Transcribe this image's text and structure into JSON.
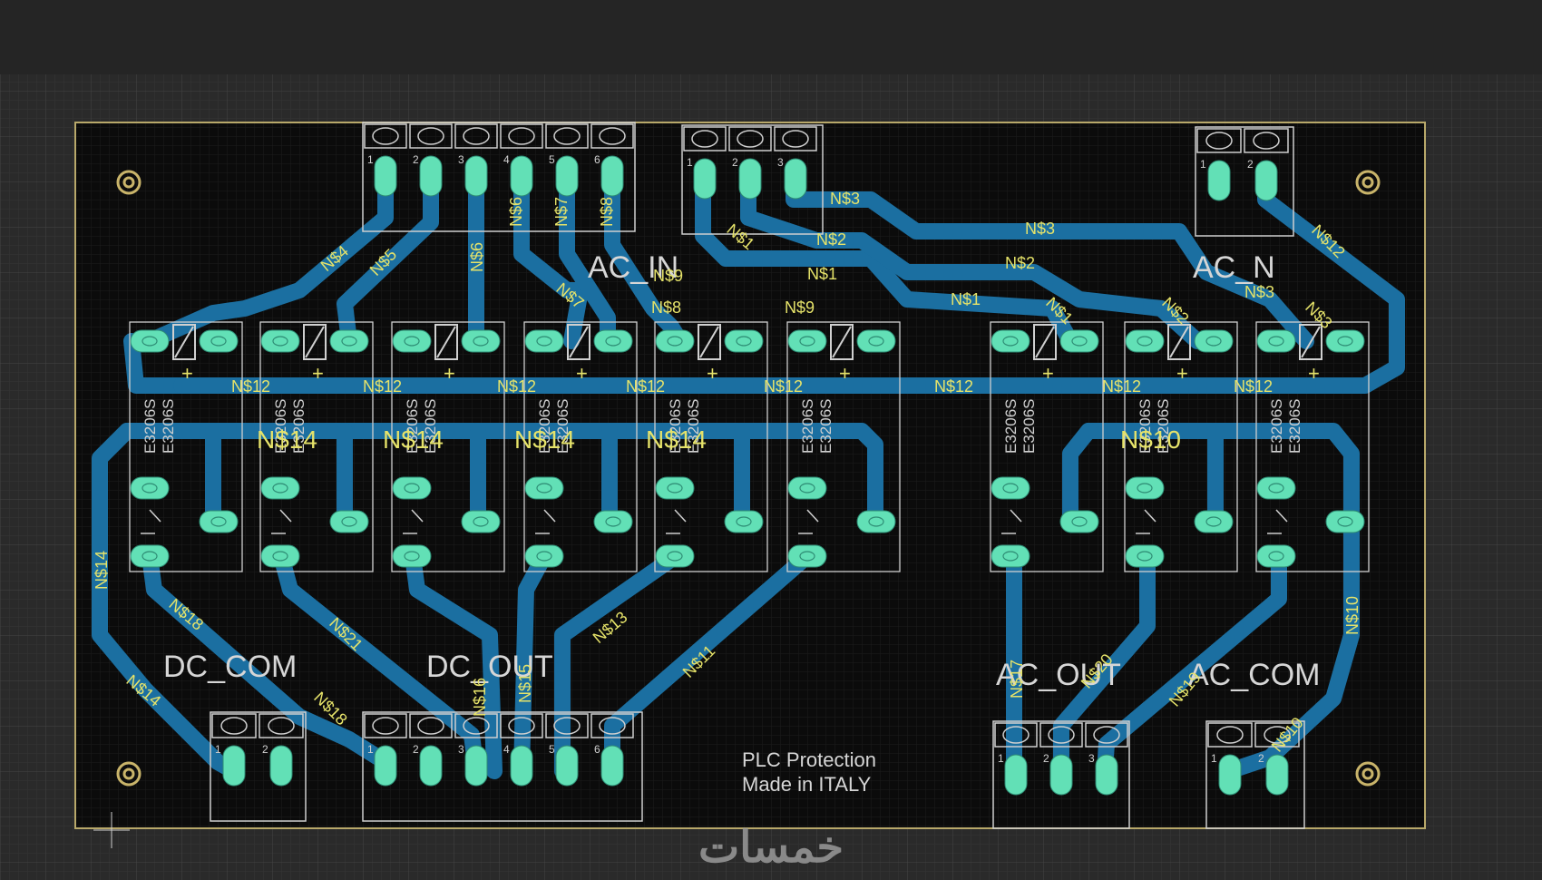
{
  "colors": {
    "background": "#252525",
    "canvas": "#2a2a2a",
    "grid": "#3a3a3a",
    "board_fill": "#0b0b0b",
    "board_outline": "#b8a86a",
    "trace": "#1b6fa1",
    "pad": "#62e0b6",
    "silk": "#d0d0d0",
    "net_label": "#e6e36a",
    "watermark": "#9a9a9a"
  },
  "connectors": {
    "top_left_pins": [
      "1",
      "2",
      "3",
      "4",
      "5",
      "6"
    ],
    "top_mid_pins": [
      "1",
      "2",
      "3"
    ],
    "top_right_pins": [
      "1",
      "2"
    ],
    "bottom_left_pins": [
      "1",
      "2"
    ],
    "bottom_mid_pins": [
      "1",
      "2",
      "3",
      "4",
      "5",
      "6"
    ],
    "bottom_ac_out_pins": [
      "1",
      "2",
      "3"
    ],
    "bottom_ac_com_pins": [
      "1",
      "2"
    ]
  },
  "silkscreen": {
    "ac_in": "AC_IN",
    "ac_n": "AC_N",
    "dc_com": "DC_COM",
    "dc_out": "DC_OUT",
    "ac_out": "AC_OUT",
    "ac_com": "AC_COM",
    "credit_line1": "PLC Protection",
    "credit_line2": "Made in ITALY",
    "relay_part": "E3206S",
    "plus_sign": "+"
  },
  "nets": {
    "ns1": "N$1",
    "ns2": "N$2",
    "ns3": "N$3",
    "ns4": "N$4",
    "ns5": "N$5",
    "ns6": "N$6",
    "ns7": "N$7",
    "ns8": "N$8",
    "ns9": "N$9",
    "ns10": "N$10",
    "ns11": "N$11",
    "ns12": "N$12",
    "ns13": "N$13",
    "ns14": "N$14",
    "ns15": "N$15",
    "ns16": "N$16",
    "ns17": "N$17",
    "ns18": "N$18",
    "ns19": "N$19",
    "ns20": "N$20",
    "ns21": "N$21"
  },
  "watermark": "خمسات"
}
